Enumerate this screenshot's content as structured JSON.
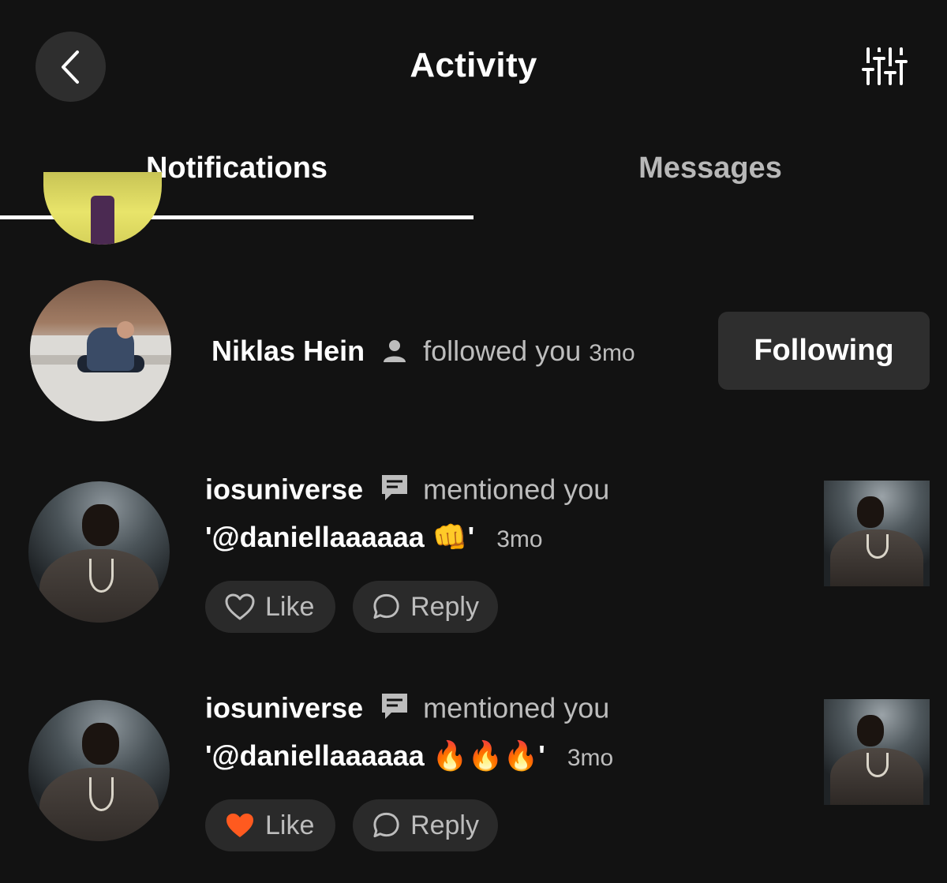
{
  "header": {
    "title": "Activity",
    "back_icon": "chevron-left-icon",
    "filter_icon": "sliders-icon"
  },
  "tabs": [
    {
      "label": "Notifications",
      "active": true
    },
    {
      "label": "Messages",
      "active": false
    }
  ],
  "notifications": [
    {
      "type": "follow",
      "username": "Niklas Hein",
      "action": "followed you",
      "time": "3mo",
      "icon": "person-icon",
      "button_label": "Following"
    },
    {
      "type": "mention",
      "username": "iosuniverse",
      "action": "mentioned you",
      "comment": "'@daniellaaaaaa 👊'",
      "time": "3mo",
      "icon": "comment-icon",
      "like_label": "Like",
      "reply_label": "Reply",
      "liked": false
    },
    {
      "type": "mention",
      "username": "iosuniverse",
      "action": "mentioned you",
      "comment": "'@daniellaaaaaa 🔥🔥🔥'",
      "time": "3mo",
      "icon": "comment-icon",
      "like_label": "Like",
      "reply_label": "Reply",
      "liked": true
    }
  ],
  "colors": {
    "background": "#121212",
    "button_bg": "#2e2e2e",
    "liked_heart": "#ff5a1f",
    "muted_text": "#bdbdbd"
  }
}
